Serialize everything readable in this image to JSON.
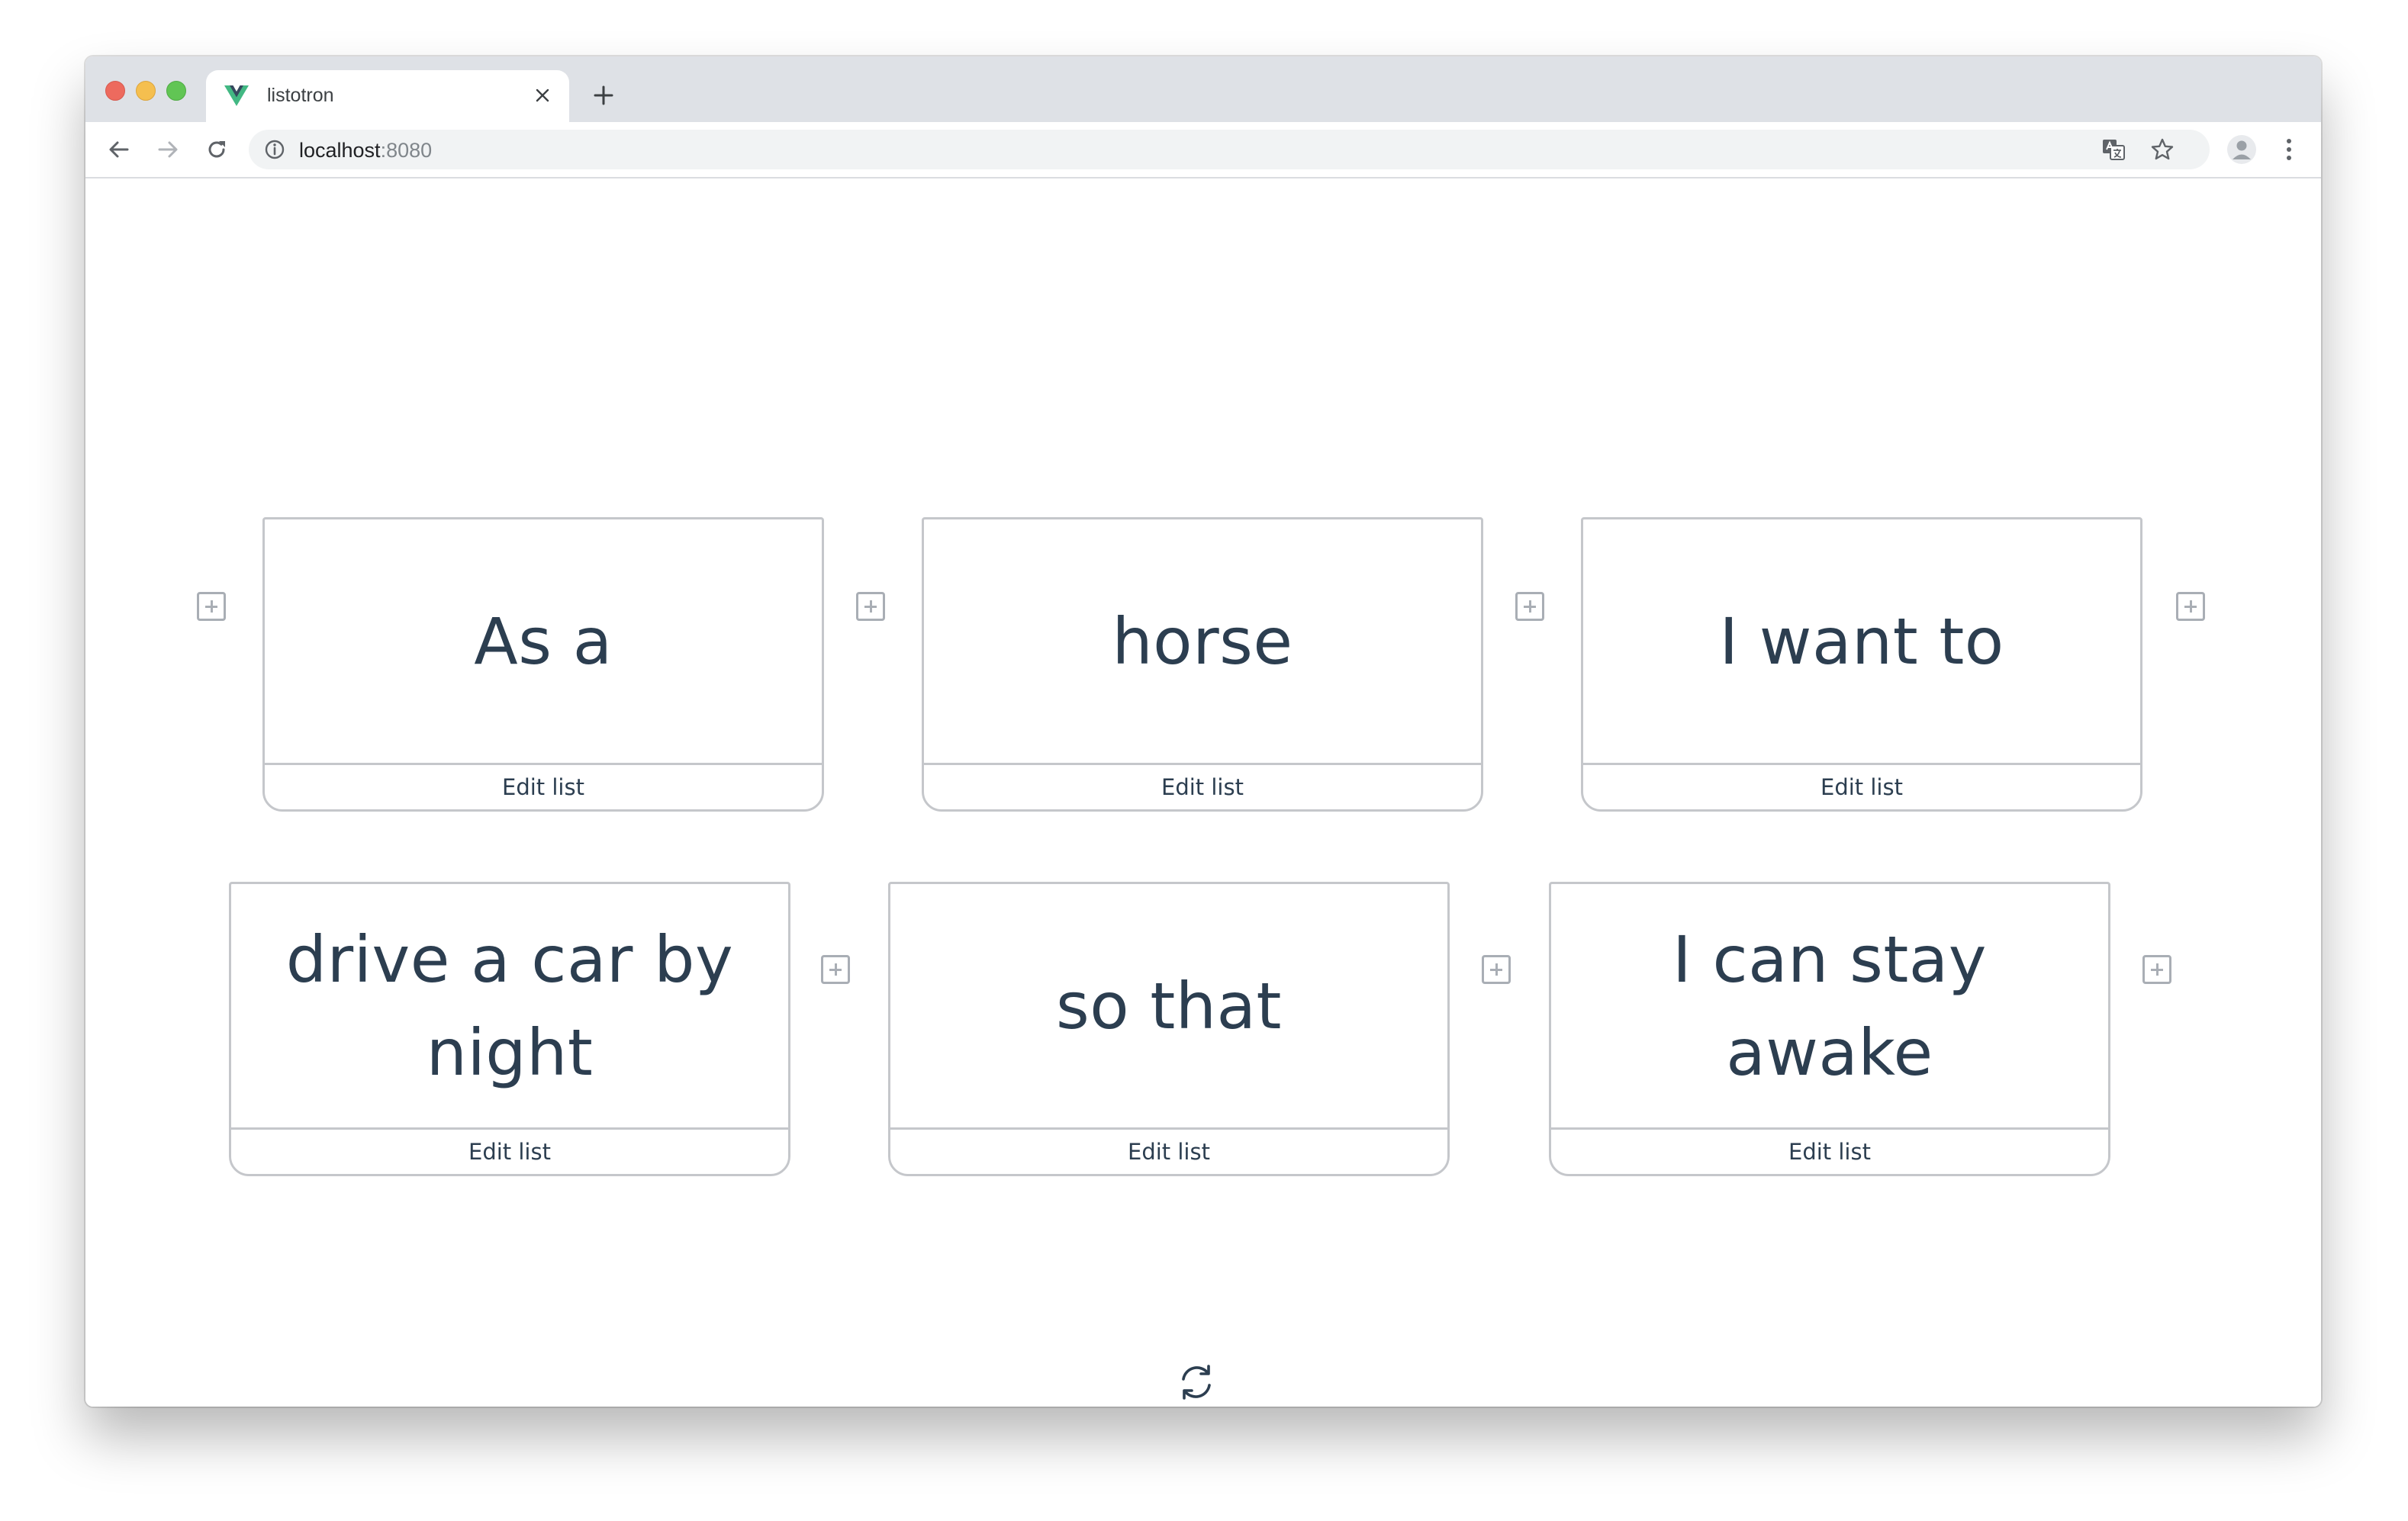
{
  "browser": {
    "tab_title": "listotron",
    "url_host": "localhost",
    "url_port": ":8080"
  },
  "cards": [
    {
      "text": "As a",
      "edit_label": "Edit list"
    },
    {
      "text": "horse",
      "edit_label": "Edit list"
    },
    {
      "text": "I want to",
      "edit_label": "Edit list"
    },
    {
      "text": "drive a car by night",
      "edit_label": "Edit list"
    },
    {
      "text": "so that",
      "edit_label": "Edit list"
    },
    {
      "text": "I can stay awake",
      "edit_label": "Edit list"
    }
  ],
  "icons": {
    "tab_favicon": "vue-logo-icon",
    "close_tab": "close-icon",
    "new_tab": "plus-icon",
    "back": "arrow-left-icon",
    "forward": "arrow-right-icon",
    "reload": "reload-icon",
    "site_info": "info-icon",
    "translate": "translate-icon",
    "bookmark": "star-icon",
    "profile": "avatar-icon",
    "menu": "kebab-menu-icon",
    "add_card": "plus-square-icon",
    "shuffle": "refresh-icon"
  },
  "colors": {
    "text": "#2c3e50",
    "card_border": "#c5c7cb",
    "plus_icon": "#a9aeb5",
    "tabstrip": "#dee1e6",
    "vue_green": "#42b883",
    "vue_dark": "#35495e"
  }
}
